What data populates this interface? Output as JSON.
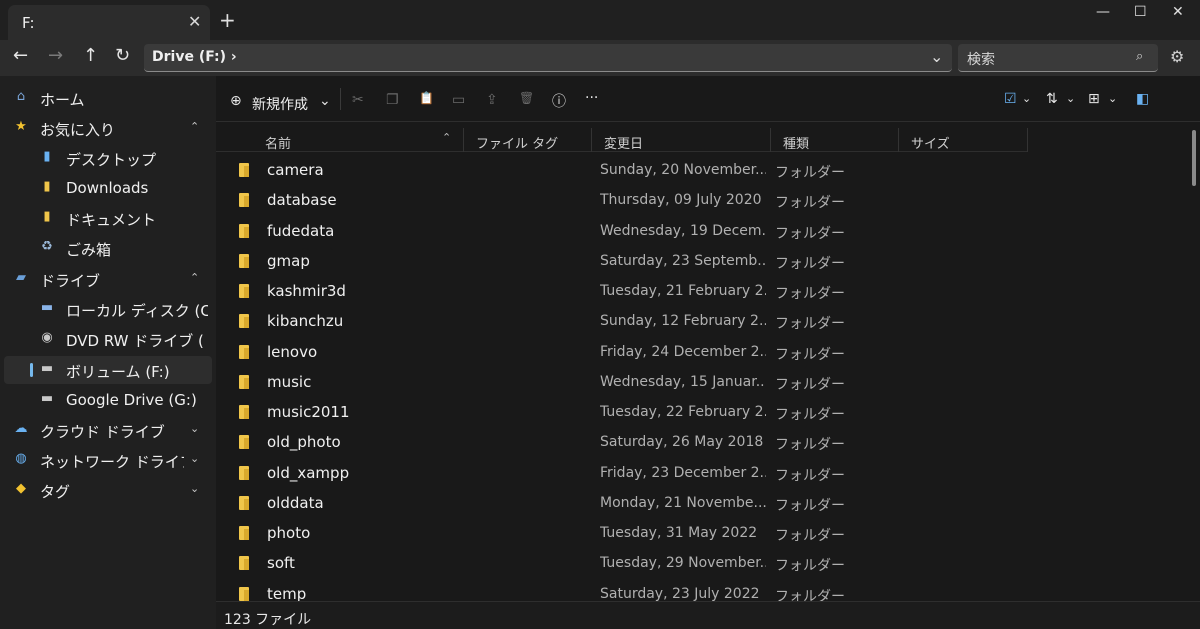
{
  "window": {
    "tab_title": "F:",
    "tab_close": "✕",
    "new_tab": "+",
    "minimize": "—",
    "maximize": "☐",
    "close": "✕"
  },
  "nav": {
    "back": "←",
    "forward": "→",
    "up": "↑",
    "refresh": "↻",
    "address": "Drive (F:) ›",
    "address_dropdown": "⌄",
    "search_placeholder": "検索",
    "search_icon": "⌕",
    "settings_icon": "⚙"
  },
  "sidebar": {
    "items": [
      {
        "label": "ホーム",
        "icon": "home-icon"
      },
      {
        "label": "お気に入り",
        "icon": "star-icon",
        "chevron": "⌃"
      },
      {
        "label": "デスクトップ",
        "icon": "desktop-icon"
      },
      {
        "label": "Downloads",
        "icon": "downloads-icon"
      },
      {
        "label": "ドキュメント",
        "icon": "documents-icon"
      },
      {
        "label": "ごみ箱",
        "icon": "recycle-bin-icon"
      },
      {
        "label": "ドライブ",
        "icon": "drive-icon",
        "chevron": "⌃"
      },
      {
        "label": "ローカル ディスク (C:",
        "icon": "local-disk-icon"
      },
      {
        "label": "DVD RW ドライブ (",
        "icon": "dvd-drive-icon"
      },
      {
        "label": "ボリューム (F:)",
        "icon": "volume-drive-icon"
      },
      {
        "label": "Google Drive (G:)",
        "icon": "google-drive-icon"
      },
      {
        "label": "クラウド ドライブ",
        "icon": "cloud-drive-icon",
        "chevron": "⌄"
      },
      {
        "label": "ネットワーク ドライブ",
        "icon": "network-drive-icon",
        "chevron": "⌄"
      },
      {
        "label": "タグ",
        "icon": "tag-icon",
        "chevron": "⌄"
      }
    ],
    "selected_index": 9
  },
  "toolbar": {
    "new_icon": "⊕",
    "new_label": "新規作成",
    "new_chevron": "⌄",
    "cut": "✂",
    "copy": "❐",
    "paste": "📋",
    "rename": "▭",
    "share": "⇪",
    "delete": "🗑",
    "properties": "ⓘ",
    "more": "···",
    "selection": "☑",
    "sort": "⇅",
    "layout": "⊞",
    "preview": "◧",
    "chevron": "⌄"
  },
  "columns": {
    "name": "名前",
    "tags": "ファイル タグ",
    "modified": "変更日",
    "type": "種類",
    "size": "サイズ",
    "sort_caret": "⌃"
  },
  "files": [
    {
      "name": "camera",
      "date": "Sunday, 20 November...",
      "type": "フォルダー"
    },
    {
      "name": "database",
      "date": "Thursday, 09 July 2020",
      "type": "フォルダー"
    },
    {
      "name": "fudedata",
      "date": "Wednesday, 19 Decem...",
      "type": "フォルダー"
    },
    {
      "name": "gmap",
      "date": "Saturday, 23 Septemb...",
      "type": "フォルダー"
    },
    {
      "name": "kashmir3d",
      "date": "Tuesday, 21 February 2...",
      "type": "フォルダー"
    },
    {
      "name": "kibanchzu",
      "date": "Sunday, 12 February 2...",
      "type": "フォルダー"
    },
    {
      "name": "lenovo",
      "date": "Friday, 24 December 2...",
      "type": "フォルダー"
    },
    {
      "name": "music",
      "date": "Wednesday, 15 Januar...",
      "type": "フォルダー"
    },
    {
      "name": "music2011",
      "date": "Tuesday, 22 February 2...",
      "type": "フォルダー"
    },
    {
      "name": "old_photo",
      "date": "Saturday, 26 May 2018",
      "type": "フォルダー"
    },
    {
      "name": "old_xampp",
      "date": "Friday, 23 December 2...",
      "type": "フォルダー"
    },
    {
      "name": "olddata",
      "date": "Monday, 21 Novembe...",
      "type": "フォルダー"
    },
    {
      "name": "photo",
      "date": "Tuesday, 31 May 2022",
      "type": "フォルダー"
    },
    {
      "name": "soft",
      "date": "Tuesday, 29 November...",
      "type": "フォルダー"
    },
    {
      "name": "temp",
      "date": "Saturday, 23 July 2022",
      "type": "フォルダー"
    }
  ],
  "status": "123 ファイル",
  "colors": {
    "accent": "#76b9ed",
    "folder": "#f0c64a"
  }
}
